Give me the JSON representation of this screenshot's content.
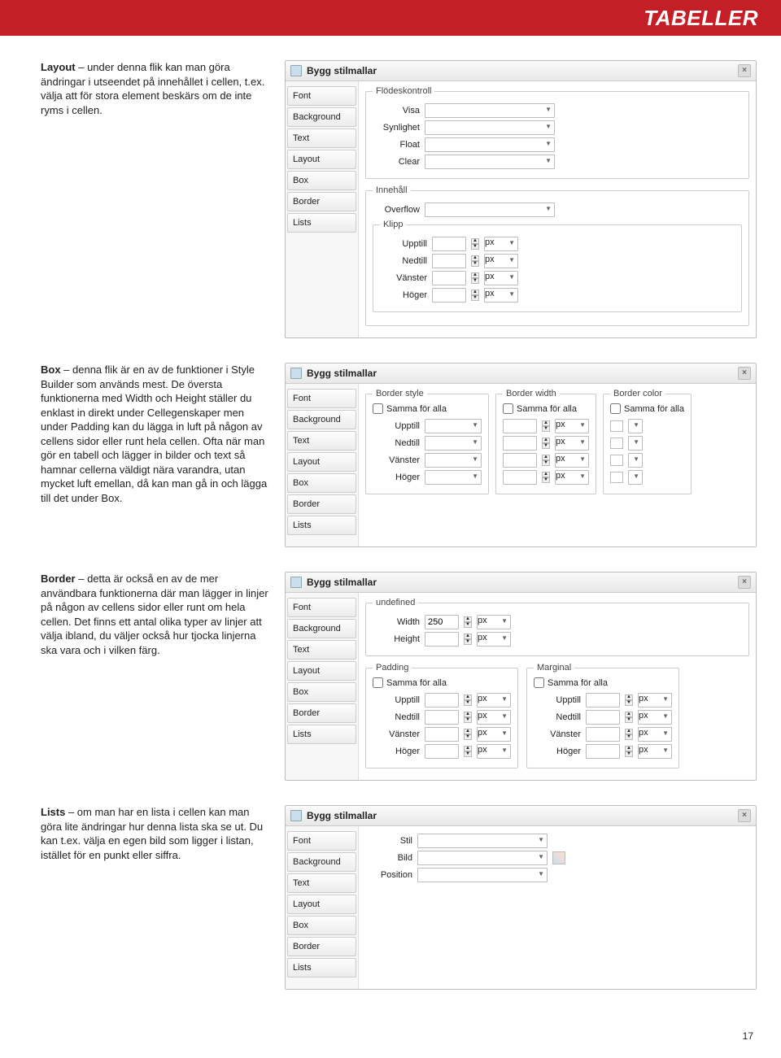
{
  "header": {
    "title": "TABELLER"
  },
  "tabs": [
    "Font",
    "Background",
    "Text",
    "Layout",
    "Box",
    "Border",
    "Lists"
  ],
  "dialog_title": "Bygg stilmallar",
  "sections": {
    "layout": {
      "heading": "Layout",
      "body": " – under denna flik kan man göra ändringar i utseendet på innehållet i cellen, t.ex. välja att för stora element beskärs om de inte ryms i cellen.",
      "fs1": "Flödeskontroll",
      "labels1": [
        "Visa",
        "Synlighet",
        "Float",
        "Clear"
      ],
      "fs2": "Innehåll",
      "overflow": "Overflow",
      "fs3": "Klipp",
      "clip_labels": [
        "Upptill",
        "Nedtill",
        "Vänster",
        "Höger"
      ],
      "unit": "px"
    },
    "box": {
      "heading": "Box",
      "body": " – denna flik är en av de funktioner i Style Builder som används mest. De översta funktionerna med Width och Height ställer du enklast in direkt under Cellegenskaper men under Padding kan du lägga in luft på någon av cellens sidor eller runt hela cellen. Ofta när man gör en tabell och lägger in bilder och text så hamnar cellerna väldigt nära varandra, utan mycket luft emellan, då kan man gå in och lägga till det under Box.",
      "fs_style": "Border style",
      "fs_width": "Border width",
      "fs_color": "Border color",
      "same_all": "Samma för alla",
      "sides": [
        "Upptill",
        "Nedtill",
        "Vänster",
        "Höger"
      ],
      "unit": "px"
    },
    "border": {
      "heading": "Border",
      "body": " – detta är också en av de mer användbara funktionerna där man lägger in linjer på någon av cellens sidor eller runt om hela cellen. Det finns ett antal olika typer av linjer att välja ibland, du väljer också hur tjocka linjerna ska vara och i vilken färg.",
      "fs1": "undefined",
      "width_lbl": "Width",
      "width_val": "250",
      "height_lbl": "Height",
      "unit": "px",
      "fs_padding": "Padding",
      "fs_margin": "Marginal",
      "same_all": "Samma för alla",
      "sides": [
        "Upptill",
        "Nedtill",
        "Vänster",
        "Höger"
      ]
    },
    "lists": {
      "heading": "Lists",
      "body": " – om man har en lista i cellen kan man göra lite ändringar hur denna lista ska se ut. Du kan t.ex. välja en egen bild som ligger i listan, istället för en punkt eller siffra.",
      "labels": [
        "Stil",
        "Bild",
        "Position"
      ]
    }
  },
  "page_number": "17"
}
